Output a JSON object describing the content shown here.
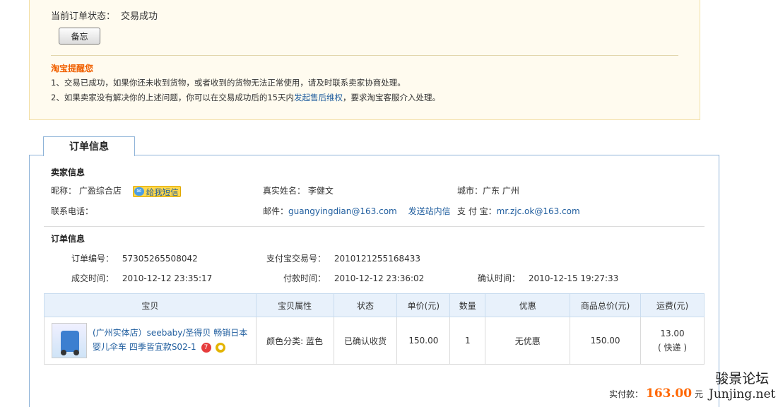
{
  "status": {
    "label": "当前订单状态：",
    "value": "交易成功",
    "memo_button": "备忘"
  },
  "tips": {
    "title": "淘宝提醒您",
    "line1": "1、交易已成功，如果你还未收到货物，或者收到的货物无法正常使用，请及时联系卖家协商处理。",
    "line2_prefix": "2、如果卖家没有解决你的上述问题，你可以在交易成功后的15天内",
    "line2_link": "发起售后维权",
    "line2_suffix": "，要求淘宝客服介入处理。"
  },
  "tab_label": "订单信息",
  "seller": {
    "section_title": "卖家信息",
    "nickname_label": "昵称：",
    "nickname": "广盈综合店",
    "sms_label": "给我短信",
    "realname_label": "真实姓名：",
    "realname": "李健文",
    "city_label": "城市：",
    "city": "广东 广州",
    "phone_label": "联系电话：",
    "email_label": "邮件：",
    "email": "guangyingdian@163.com",
    "send_msg": "发送站内信",
    "alipay_label": "支 付 宝：",
    "alipay": "mr.zjc.ok@163.com"
  },
  "order": {
    "section_title": "订单信息",
    "order_no_label": "订单编号：",
    "order_no": "57305265508042",
    "alipay_no_label": "支付宝交易号：",
    "alipay_no": "2010121255168433",
    "deal_time_label": "成交时间：",
    "deal_time": "2010-12-12 23:35:17",
    "pay_time_label": "付款时间：",
    "pay_time": "2010-12-12 23:36:02",
    "confirm_time_label": "确认时间：",
    "confirm_time": "2010-12-15 19:27:33"
  },
  "table": {
    "headers": [
      "宝贝",
      "宝贝属性",
      "状态",
      "单价(元)",
      "数量",
      "优惠",
      "商品总价(元)",
      "运费(元)"
    ],
    "row": {
      "title": "(广州实体店）seebaby/圣得贝 畅销日本婴儿伞车 四季皆宜款S02-1",
      "attr": "颜色分类: 蓝色",
      "status": "已确认收货",
      "price": "150.00",
      "qty": "1",
      "discount": "无优惠",
      "total": "150.00",
      "shipping": "13.00",
      "shipping_type": "( 快递 )"
    }
  },
  "summary": {
    "label": "实付款：",
    "amount": "163.00",
    "unit": "元"
  },
  "watermark": {
    "cn": "骏景论坛",
    "en": "Junjing.net"
  },
  "colors": {
    "accent_orange": "#ff6600",
    "link_blue": "#1f5d9e",
    "tip_orange": "#f06000",
    "panel_border": "#8eb3d8",
    "status_bg": "#fffbef"
  }
}
